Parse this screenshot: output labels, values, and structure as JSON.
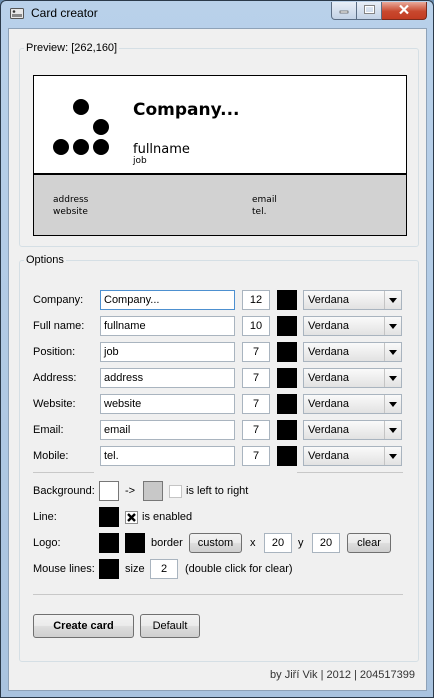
{
  "window": {
    "title": "Card creator"
  },
  "preview": {
    "legend": "Preview: [262,160]",
    "company": "Company...",
    "fullname": "fullname",
    "job": "job",
    "address": "address",
    "website": "website",
    "email": "email",
    "tel": "tel."
  },
  "options": {
    "legend": "Options",
    "rows": [
      {
        "label": "Company:",
        "value": "Company...",
        "size": "12",
        "font": "Verdana"
      },
      {
        "label": "Full name:",
        "value": "fullname",
        "size": "10",
        "font": "Verdana"
      },
      {
        "label": "Position:",
        "value": "job",
        "size": "7",
        "font": "Verdana"
      },
      {
        "label": "Address:",
        "value": "address",
        "size": "7",
        "font": "Verdana"
      },
      {
        "label": "Website:",
        "value": "website",
        "size": "7",
        "font": "Verdana"
      },
      {
        "label": "Email:",
        "value": "email",
        "size": "7",
        "font": "Verdana"
      },
      {
        "label": "Mobile:",
        "value": "tel.",
        "size": "7",
        "font": "Verdana"
      }
    ],
    "background": {
      "label": "Background:",
      "arrow": "->",
      "checkbox_label": "is left to right",
      "checked": false
    },
    "line": {
      "label": "Line:",
      "checkbox_label": "is enabled",
      "checked": true
    },
    "logo": {
      "label": "Logo:",
      "border_label": "border",
      "custom_button": "custom",
      "x_label": "x",
      "x_value": "20",
      "y_label": "y",
      "y_value": "20",
      "clear_button": "clear"
    },
    "mouse_lines": {
      "label": "Mouse lines:",
      "size_label": "size",
      "size_value": "2",
      "hint": "(double click for clear)"
    }
  },
  "buttons": {
    "create": "Create card",
    "default": "Default"
  },
  "footer": "by Jiří Vik | 2012 | 204517399",
  "colors": {
    "card_bottom": "#d2d2d2",
    "background_to": "#c8c8c8",
    "swatch": "#000000"
  }
}
